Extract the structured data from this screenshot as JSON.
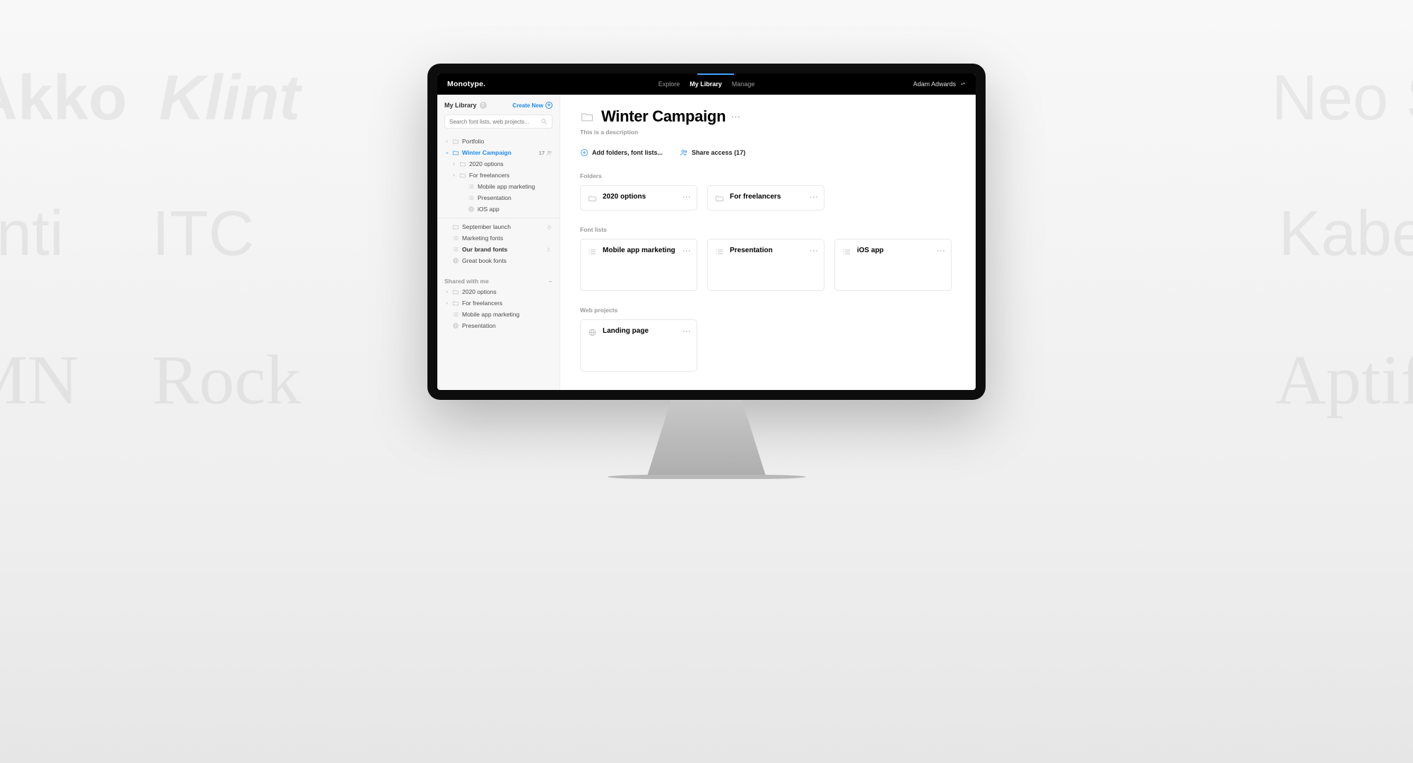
{
  "background_words": [
    "Akko",
    "Klint",
    "Neo S",
    "wenti",
    "ITC",
    "Kabel",
    "MN",
    "Rock",
    "Aptife"
  ],
  "brand": "Monotype.",
  "nav": {
    "explore": "Explore",
    "library": "My Library",
    "manage": "Manage"
  },
  "user": {
    "name": "Adam Adwards"
  },
  "sidebar": {
    "title": "My Library",
    "create": "Create New",
    "search_placeholder": "Search font lists, web projects...",
    "portfolio": "Portfolio",
    "winter": {
      "label": "Winter Campaign",
      "count": "17"
    },
    "children": {
      "opt2020": "2020 options",
      "freelancers": "For freelancers",
      "mobile": "Mobile app marketing",
      "presentation": "Presentation",
      "ios": "iOS app"
    },
    "other": {
      "september": "September launch",
      "marketing": "Marketing fonts",
      "brand": "Our brand fonts",
      "book": "Great book fonts"
    },
    "shared_header": "Shared with me",
    "shared": {
      "opt2020": "2020 options",
      "freelancers": "For freelancers",
      "mobile": "Mobile app marketing",
      "presentation": "Presentation"
    }
  },
  "page": {
    "title": "Winter Campaign",
    "desc": "This is a description",
    "add_action": "Add folders, font lists...",
    "share_action": "Share access (17)",
    "sections": {
      "folders": "Folders",
      "fontlists": "Font lists",
      "webprojects": "Web projects"
    },
    "folders": {
      "f1": "2020 options",
      "f2": "For freelancers"
    },
    "fontlists": {
      "l1": "Mobile app marketing",
      "l2": "Presentation",
      "l3": "iOS app"
    },
    "webprojects": {
      "w1": "Landing page"
    }
  }
}
